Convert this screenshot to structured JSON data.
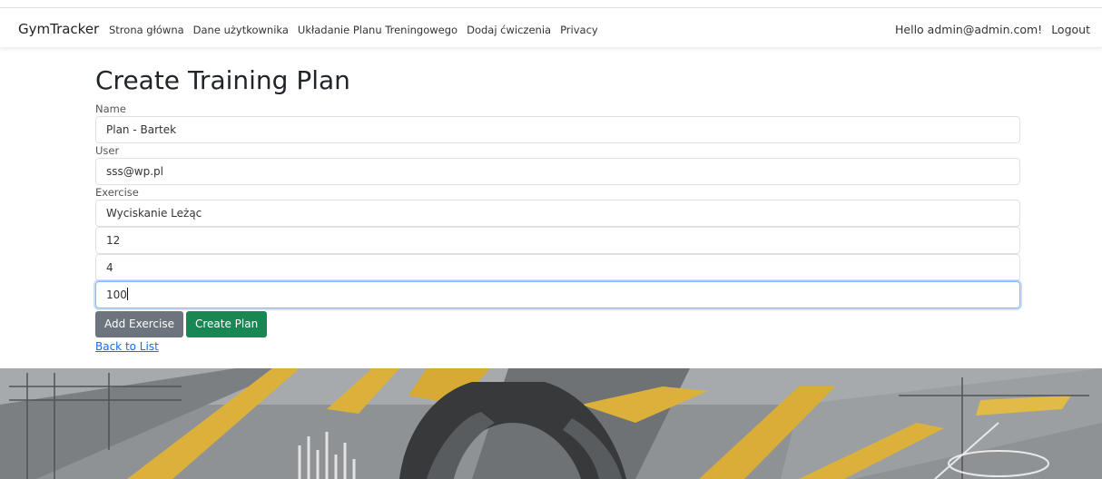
{
  "navbar": {
    "brand": "GymTracker",
    "links": [
      "Strona główna",
      "Dane użytkownika",
      "Układanie Planu Treningowego",
      "Dodaj ćwiczenia",
      "Privacy"
    ],
    "greeting": "Hello admin@admin.com!",
    "logout": "Logout"
  },
  "page": {
    "title": "Create Training Plan",
    "name_label": "Name",
    "name_value": "Plan - Bartek",
    "user_label": "User",
    "user_value": "sss@wp.pl",
    "exercise_label": "Exercise",
    "exercise_value": "Wyciskanie Leżąc",
    "reps_value": "12",
    "sets_value": "4",
    "weight_value": "100",
    "add_exercise": "Add Exercise",
    "create_plan": "Create Plan",
    "back": "Back to List"
  },
  "colors": {
    "primary": "#0d6efd",
    "secondary": "#6c757d",
    "success": "#198754",
    "banner_yellow": "#e0b43a"
  }
}
